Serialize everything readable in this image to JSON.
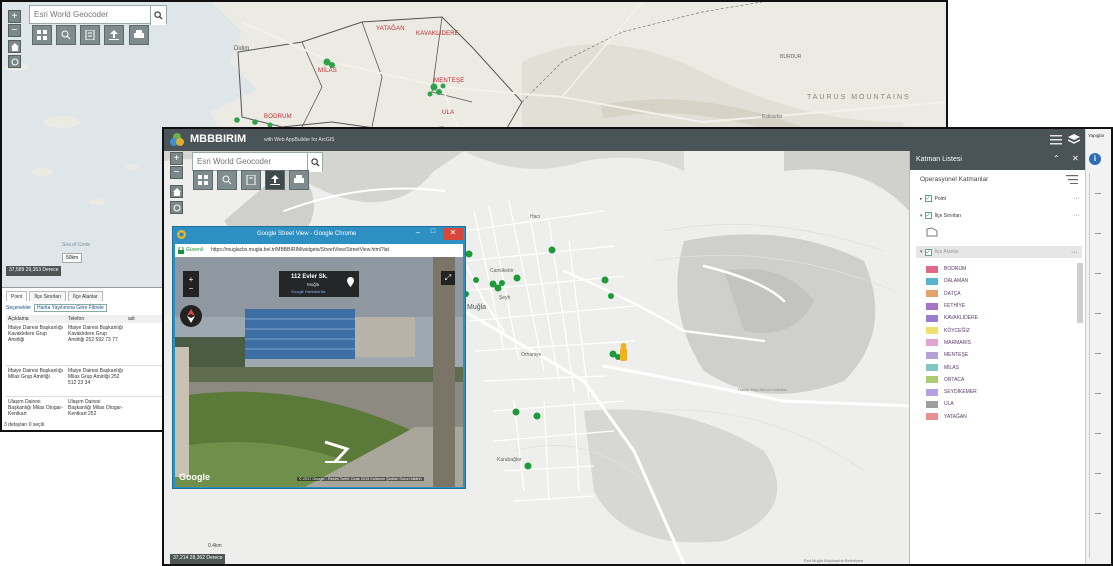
{
  "back_window": {
    "geocoder_placeholder": "Esri World Geocoder",
    "towns": {
      "milas": "MİLAS",
      "yatagan": "YATAĞAN",
      "kavaklidere": "KAVAKLIDERE",
      "mentese": "MENTEŞE",
      "ula": "ULA",
      "bodrum": "BODRUM"
    },
    "map_labels": {
      "didim": "Didim",
      "taurus": "TAURUS  MOUNTAINS",
      "burdur": "BURDUR",
      "eskisehir": "Eskisehir",
      "sea": "Sea of Crete"
    },
    "scale_label": "50km",
    "coordinates": "37,589 29,353 Derece",
    "table": {
      "tabs": [
        "Point",
        "İlçe Sınırları",
        "İlçe Alanlar"
      ],
      "options_label": "Seçenekler",
      "filter_label": "Harita Yayılımına Göre Filtrele",
      "columns": [
        "Açıklama",
        "Telefon",
        "adi"
      ],
      "rows": [
        {
          "aciklama": "İtfaiye Dairesi Başkanlığı Kavaklıdere Grup Amirliği",
          "telefon": "İtfaiye Dairesi Başkanlığı Kavaklıdere Grup Amirliği 252 592 73 77"
        },
        {
          "aciklama": "İtfaiye Dairesi Başkanlığı Milas Grup Amirliği",
          "telefon": "İtfaiye Dairesi Başkanlığı Milas Grup Amirliği 252 512 23 34"
        },
        {
          "aciklama": "Ulaşım Dairesi Başkanlığı Milas Otogar-Kentkart",
          "telefon": "Ulaşım Dairesi Başkanlığı Milas Otogar-Kentkart 252"
        }
      ],
      "footer": "3 detayları 0 seçili"
    }
  },
  "front_window": {
    "app_title": "MBBBIRIM",
    "app_subtitle": "with Web AppBuilder for ArcGIS",
    "geocoder_placeholder": "Esri World Geocoder",
    "corner_label": "Yapıglar",
    "coordinates": "37,214 28,362 Derece",
    "map_labels": {
      "mugla": "Muğla",
      "orhaniye": "Orhaniye",
      "karabaglar": "Karabağlar",
      "cami": "Camiikebir",
      "seyh": "Şeyh",
      "hacikayi": "Hacı",
      "road": "Halide Edip Adıvar Caddesi",
      "scale": "0.4km",
      "attribution": "Esri Muğla Büyükşehir Belediyesi"
    },
    "layer_panel": {
      "title": "Katman Listesi",
      "section": "Operasyonel Katmanlar",
      "layers": [
        {
          "name": "Point",
          "checked": true
        },
        {
          "name": "İlçe Sınırları",
          "checked": true
        },
        {
          "name": "İlçe Alanlar",
          "checked": true
        }
      ],
      "legend": [
        {
          "name": "BODRUM",
          "color": "#e2688a"
        },
        {
          "name": "DALAMAN",
          "color": "#56b5cf"
        },
        {
          "name": "DATÇA",
          "color": "#e4a36a"
        },
        {
          "name": "FETHİYE",
          "color": "#a873c4"
        },
        {
          "name": "KAVAKLIDERE",
          "color": "#9c7bd1"
        },
        {
          "name": "KÖYCEĞİZ",
          "color": "#f1de6e"
        },
        {
          "name": "MARMARİS",
          "color": "#e2a4d0"
        },
        {
          "name": "MENTEŞE",
          "color": "#b7a0d8"
        },
        {
          "name": "MİLAS",
          "color": "#7fc6c5"
        },
        {
          "name": "ORTACA",
          "color": "#a9cc6e"
        },
        {
          "name": "SEYDİKEMER",
          "color": "#b8a0e0"
        },
        {
          "name": "ULA",
          "color": "#9e9e9e"
        },
        {
          "name": "YATAĞAN",
          "color": "#ec8f8f"
        }
      ]
    },
    "street_view": {
      "window_title": "Google Street View - Google Chrome",
      "secure_label": "Güvenli",
      "url": "https://muglacbs.mugla.bel.tr/MBBBIRIM/widgets/StreetView/StreetView.html?lat",
      "address": "112 Evler Sk.",
      "city": "Muğla",
      "maps_link": "Google Haritalar'da",
      "google_logo": "Google",
      "footer": "© 2017 Google - Resim Tarihi: Ocak 2015   Kullanım Şartları   Sorun bildirin"
    }
  }
}
